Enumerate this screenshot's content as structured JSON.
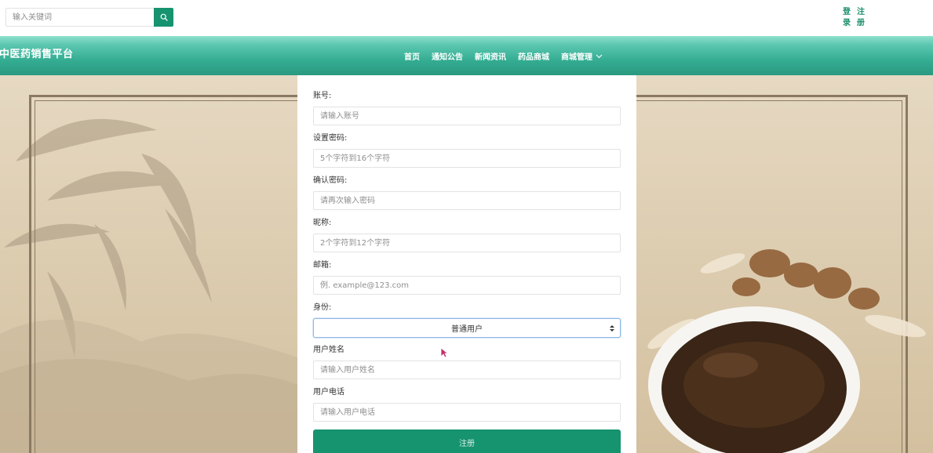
{
  "header": {
    "search": {
      "placeholder": "输入关键词"
    },
    "auth": {
      "login_1": "登",
      "login_2": "录",
      "register_1": "注",
      "register_2": "册"
    }
  },
  "nav": {
    "brand": "中医药销售平台",
    "items": [
      {
        "label": "首页"
      },
      {
        "label": "通知公告"
      },
      {
        "label": "新闻资讯"
      },
      {
        "label": "药品商城"
      },
      {
        "label": "商城管理"
      }
    ]
  },
  "form": {
    "account": {
      "label": "账号:",
      "placeholder": "请输入账号"
    },
    "password": {
      "label": "设置密码:",
      "placeholder": "5个字符到16个字符"
    },
    "confirm_password": {
      "label": "确认密码:",
      "placeholder": "请再次输入密码"
    },
    "nickname": {
      "label": "昵称:",
      "placeholder": "2个字符到12个字符"
    },
    "email": {
      "label": "邮箱:",
      "placeholder": "例. example@123.com"
    },
    "identity": {
      "label": "身份:",
      "selected": "普通用户"
    },
    "real_name": {
      "label": "用户姓名",
      "placeholder": "请输入用户姓名"
    },
    "phone": {
      "label": "用户电话",
      "placeholder": "请输入用户电话"
    },
    "submit_label": "注册"
  },
  "colors": {
    "primary": "#16936f",
    "nav_top": "#8fe0cd",
    "nav_bottom": "#2a9a80",
    "auth_text": "#1d8e6e"
  }
}
